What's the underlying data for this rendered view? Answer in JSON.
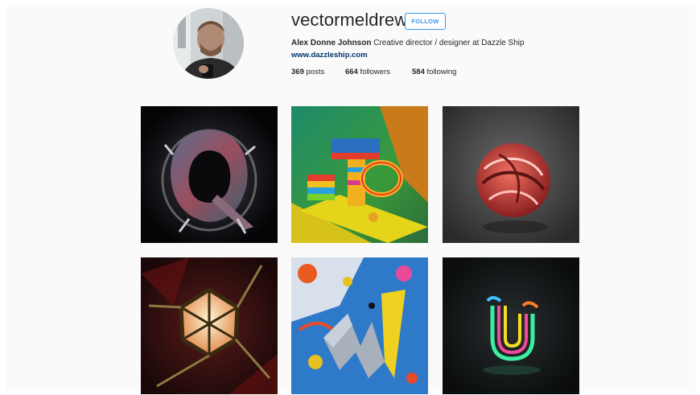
{
  "profile": {
    "username": "vectormeldrew",
    "follow_label": "FOLLOW",
    "full_name": "Alex Donne Johnson",
    "bio": "Creative director / designer at Dazzle Ship",
    "website": "www.dazzleship.com",
    "posts_count": "369",
    "posts_label": "posts",
    "followers_count": "664",
    "followers_label": "followers",
    "following_count": "584",
    "following_label": "following"
  },
  "posts": [
    {
      "subject": "dark-3d-letter-q"
    },
    {
      "subject": "colorful-3d-letter-t"
    },
    {
      "subject": "red-swirl-sphere"
    },
    {
      "subject": "glowing-polyhedron-lamp"
    },
    {
      "subject": "paint-splatter-letter-m"
    },
    {
      "subject": "neon-letter-u"
    }
  ],
  "colors": {
    "follow_blue": "#3897f0",
    "link_blue": "#003569",
    "text": "#262626",
    "background": "#fafafa"
  }
}
